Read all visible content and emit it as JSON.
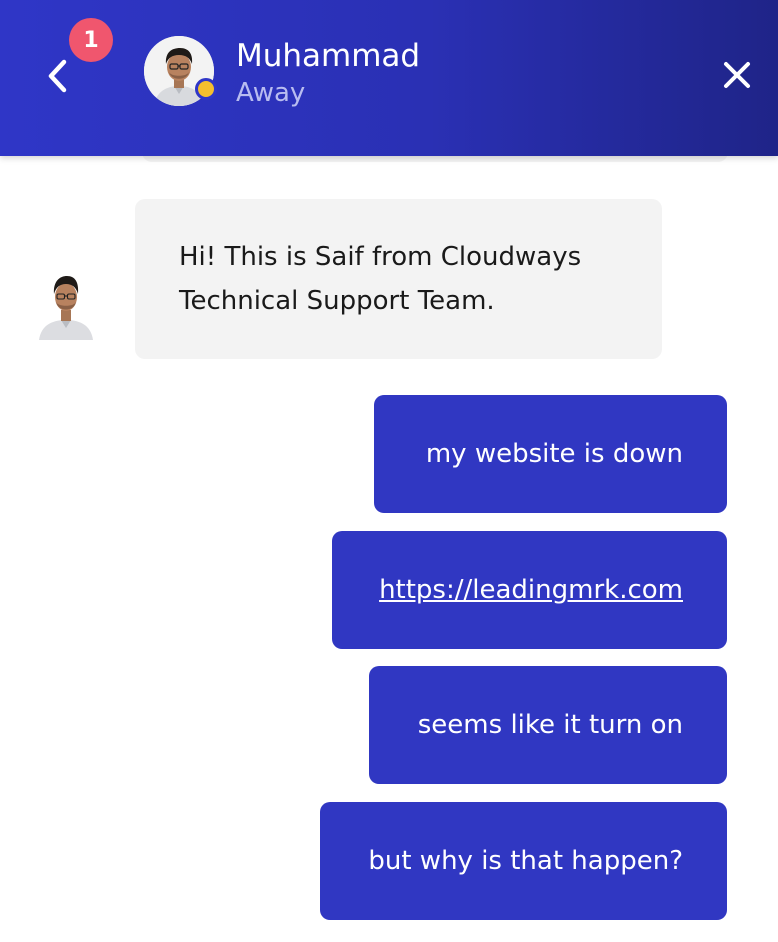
{
  "header": {
    "back_icon": "chevron-left-icon",
    "unread_count": "1",
    "agent": {
      "name": "Muhammad",
      "status": "Away",
      "status_color": "#f5bf2e"
    },
    "close_icon": "close-icon",
    "accent_color": "#2f36c7"
  },
  "messages": [
    {
      "direction": "incoming",
      "text": "Hi! This is Saif from Cloudways Technical Support Team."
    },
    {
      "direction": "outgoing",
      "text": "my website is down"
    },
    {
      "direction": "outgoing",
      "text": "https://leadingmrk.com",
      "is_link": true
    },
    {
      "direction": "outgoing",
      "text": "seems like it turn on"
    },
    {
      "direction": "outgoing",
      "text": "but why is that happen?"
    }
  ]
}
